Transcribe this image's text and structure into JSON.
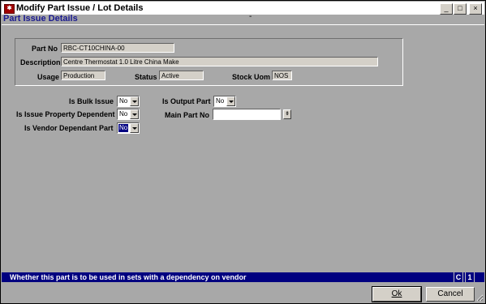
{
  "window": {
    "title": "Modify Part Issue / Lot Details",
    "app_icon": "app-logo-icon",
    "controls": [
      "minimize-icon",
      "maximize-icon",
      "close-icon"
    ]
  },
  "header": {
    "title": "Part Issue Details",
    "dash": "-",
    "title_color": "#1a1a90"
  },
  "details": {
    "part_no_label": "Part No",
    "part_no_value": "RBC-CT10CHINA-00",
    "description_label": "Description",
    "description_value": "Centre Thermostat 1.0 Litre China Make",
    "usage_label": "Usage",
    "usage_value": "Production",
    "status_label": "Status",
    "status_value": "Active",
    "stock_uom_label": "Stock Uom",
    "stock_uom_value": "NOS"
  },
  "options": {
    "bulk_issue_label": "Is Bulk Issue",
    "bulk_issue_value": "No",
    "property_dependent_label": "Is Issue Property Dependent",
    "property_dependent_value": "No",
    "vendor_dependent_label": "Is Vendor Dependant Part",
    "vendor_dependent_value": "No",
    "output_part_label": "Is Output Part",
    "output_part_value": "No",
    "main_part_label": "Main Part No",
    "main_part_value": ""
  },
  "statusbar": {
    "message": "Whether this part is to be used in sets with a dependency on vendor",
    "indicator_1": "C",
    "indicator_2": "1",
    "color": "#000080"
  },
  "buttons": {
    "ok_label": "Ok",
    "cancel_label": "Cancel"
  }
}
